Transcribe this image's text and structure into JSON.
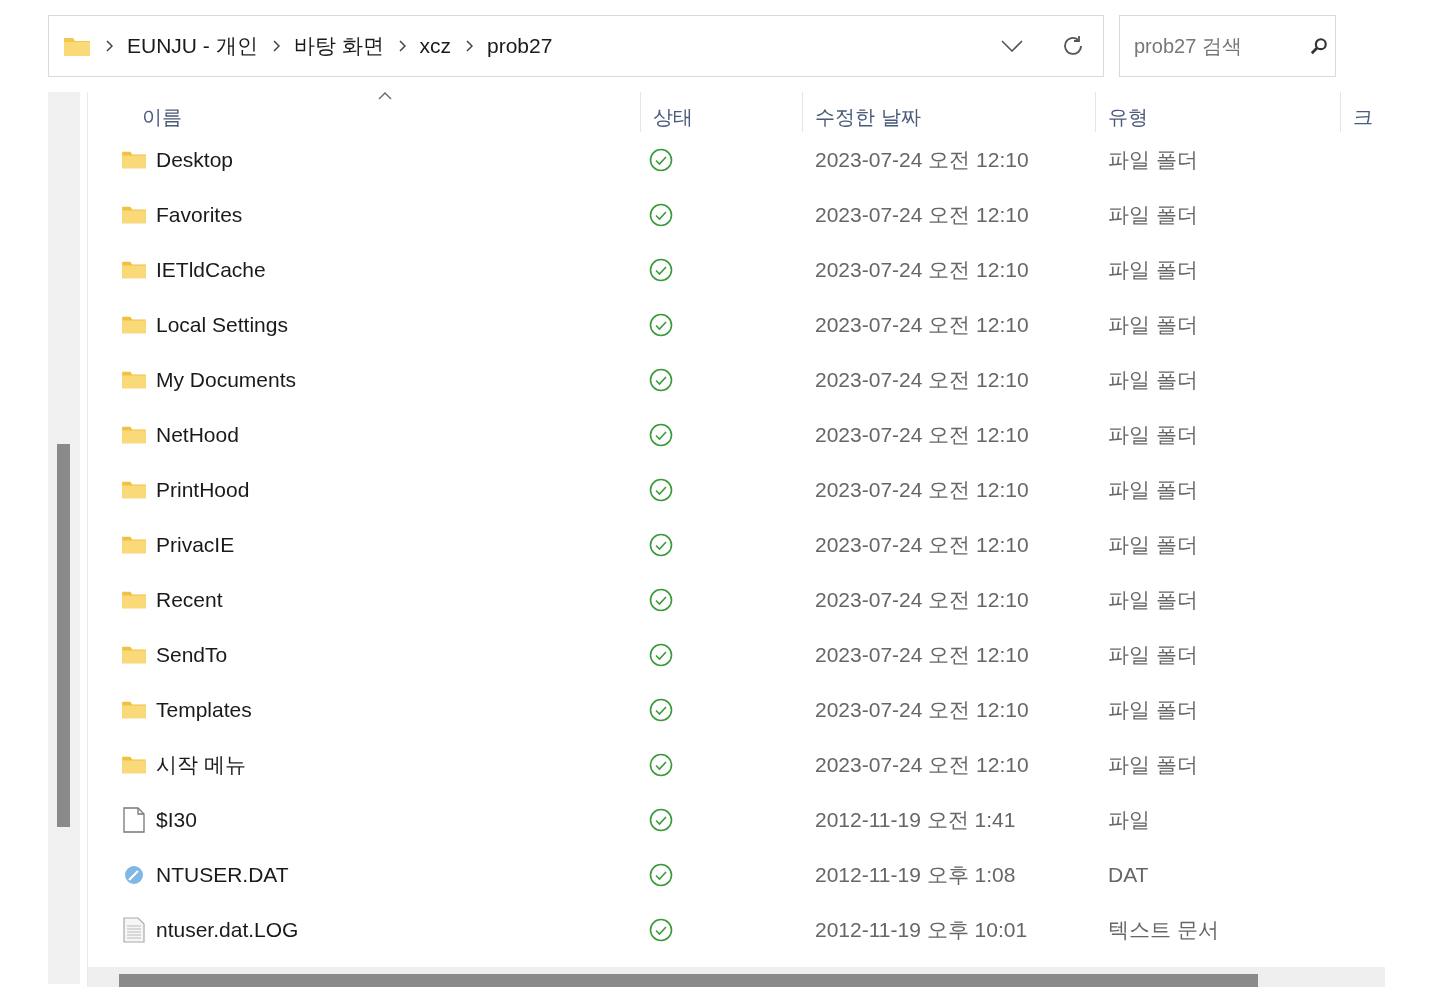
{
  "address_bar": {
    "path": [
      "EUNJU - 개인",
      "바탕 화면",
      "xcz",
      "prob27"
    ]
  },
  "search": {
    "placeholder": "prob27 검색"
  },
  "table": {
    "columns": [
      {
        "label": "이름",
        "sorted": true
      },
      {
        "label": "상태",
        "sorted": false
      },
      {
        "label": "수정한 날짜",
        "sorted": false
      },
      {
        "label": "유형",
        "sorted": false
      },
      {
        "label": "크",
        "sorted": false
      }
    ],
    "rows": [
      {
        "name": "Desktop",
        "kind": "folder",
        "synced": true,
        "modified": "2023-07-24 오전 12:10",
        "type": "파일 폴더"
      },
      {
        "name": "Favorites",
        "kind": "folder",
        "synced": true,
        "modified": "2023-07-24 오전 12:10",
        "type": "파일 폴더"
      },
      {
        "name": "IETldCache",
        "kind": "folder",
        "synced": true,
        "modified": "2023-07-24 오전 12:10",
        "type": "파일 폴더"
      },
      {
        "name": "Local Settings",
        "kind": "folder",
        "synced": true,
        "modified": "2023-07-24 오전 12:10",
        "type": "파일 폴더"
      },
      {
        "name": "My Documents",
        "kind": "folder",
        "synced": true,
        "modified": "2023-07-24 오전 12:10",
        "type": "파일 폴더"
      },
      {
        "name": "NetHood",
        "kind": "folder",
        "synced": true,
        "modified": "2023-07-24 오전 12:10",
        "type": "파일 폴더"
      },
      {
        "name": "PrintHood",
        "kind": "folder",
        "synced": true,
        "modified": "2023-07-24 오전 12:10",
        "type": "파일 폴더"
      },
      {
        "name": "PrivacIE",
        "kind": "folder",
        "synced": true,
        "modified": "2023-07-24 오전 12:10",
        "type": "파일 폴더"
      },
      {
        "name": "Recent",
        "kind": "folder",
        "synced": true,
        "modified": "2023-07-24 오전 12:10",
        "type": "파일 폴더"
      },
      {
        "name": "SendTo",
        "kind": "folder",
        "synced": true,
        "modified": "2023-07-24 오전 12:10",
        "type": "파일 폴더"
      },
      {
        "name": "Templates",
        "kind": "folder",
        "synced": true,
        "modified": "2023-07-24 오전 12:10",
        "type": "파일 폴더"
      },
      {
        "name": "시작 메뉴",
        "kind": "folder",
        "synced": true,
        "modified": "2023-07-24 오전 12:10",
        "type": "파일 폴더"
      },
      {
        "name": "$I30",
        "kind": "file",
        "synced": true,
        "modified": "2012-11-19 오전 1:41",
        "type": "파일"
      },
      {
        "name": "NTUSER.DAT",
        "kind": "dat",
        "synced": true,
        "modified": "2012-11-19 오후 1:08",
        "type": "DAT"
      },
      {
        "name": "ntuser.dat.LOG",
        "kind": "text",
        "synced": true,
        "modified": "2012-11-19 오후 10:01",
        "type": "텍스트 문서"
      }
    ]
  }
}
